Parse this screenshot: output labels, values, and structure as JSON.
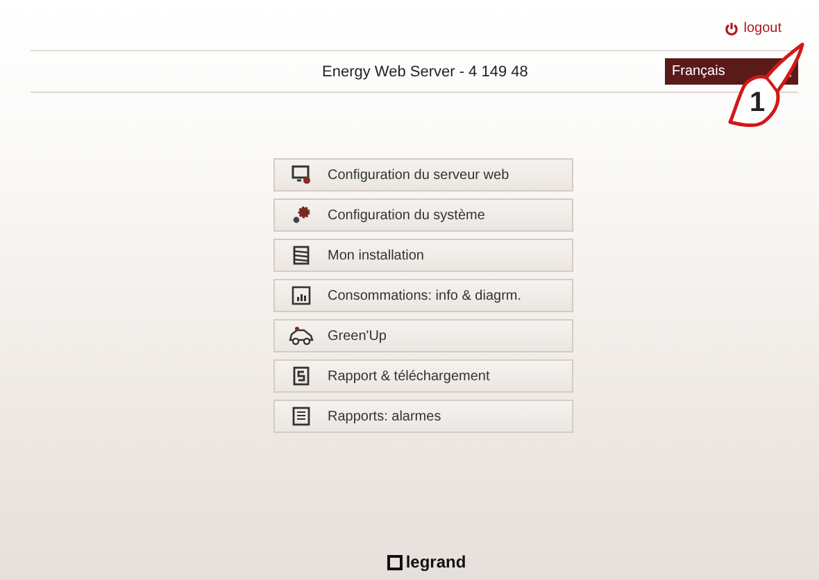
{
  "header": {
    "logout": "logout",
    "title": "Energy Web Server - 4 149 48",
    "language": "Français"
  },
  "callout": {
    "number": "1"
  },
  "menu": [
    {
      "label": "Configuration du serveur web",
      "kind": "monitor"
    },
    {
      "label": "Configuration du système",
      "kind": "gears"
    },
    {
      "label": "Mon installation",
      "kind": "stack"
    },
    {
      "label": "Consommations: info & diagrm.",
      "kind": "chart"
    },
    {
      "label": "Green'Up",
      "kind": "car"
    },
    {
      "label": "Rapport & téléchargement",
      "kind": "report"
    },
    {
      "label": "Rapports: alarmes",
      "kind": "list"
    }
  ],
  "footer": {
    "brand": "legrand"
  }
}
